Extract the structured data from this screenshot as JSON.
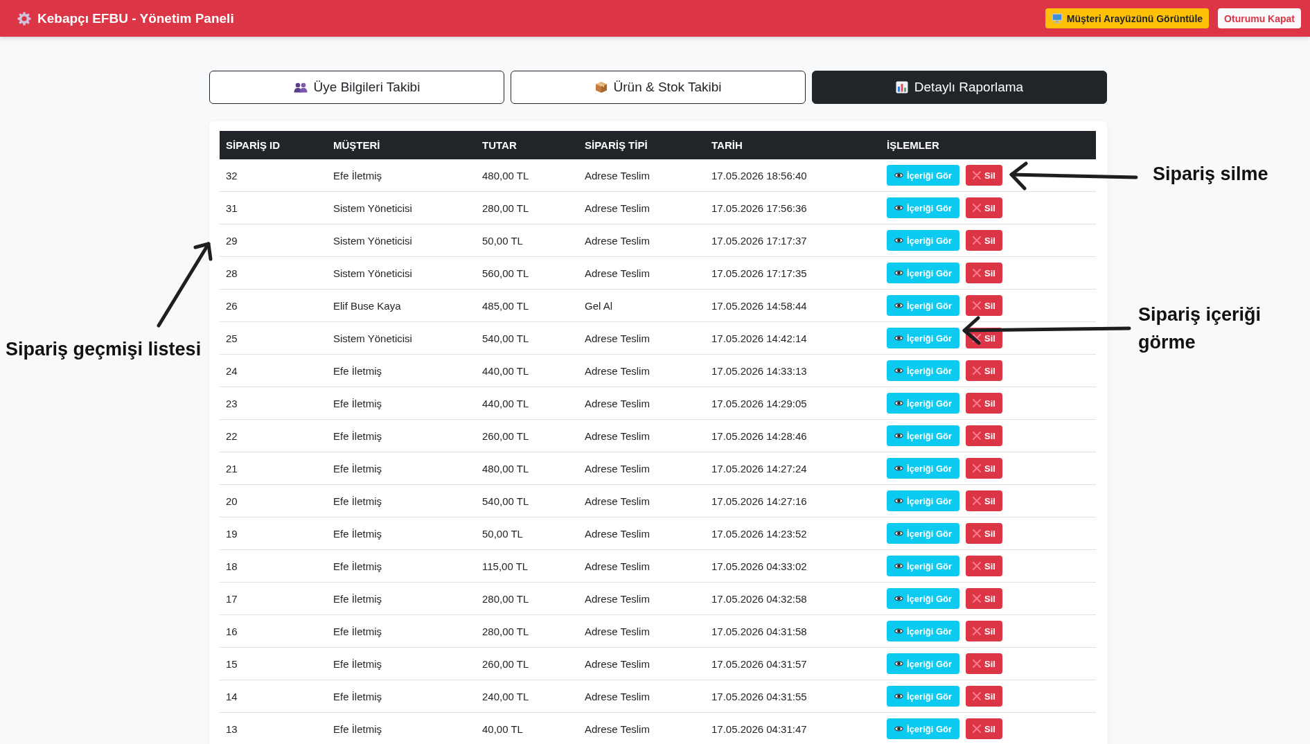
{
  "header": {
    "title": "Kebapçı EFBU - Yönetim Paneli",
    "buttons": [
      {
        "label": "Müşteri Arayüzünü Görüntüle",
        "kind": "warning"
      },
      {
        "label": "Oturumu Kapat",
        "kind": "light"
      }
    ]
  },
  "tabs": [
    {
      "label": "Üye Bilgileri Takibi",
      "selected": false
    },
    {
      "label": "Ürün & Stok Takibi",
      "selected": false
    },
    {
      "label": "Detaylı Raporlama",
      "selected": true
    }
  ],
  "orders_table": {
    "columns": [
      "SİPARİŞ ID",
      "MÜŞTERİ",
      "TUTAR",
      "SİPARİŞ TİPİ",
      "TARİH",
      "İŞLEMLER"
    ],
    "rows": [
      {
        "id": "32",
        "customer": "Efe İletmiş",
        "amount": "480,00 TL",
        "order_type": "Adrese Teslim",
        "date": "17.05.2026 18:56:40",
        "actions": [
          {
            "label": "İçeriği Gör",
            "kind": "view"
          },
          {
            "label": "Sil",
            "kind": "delete"
          }
        ]
      },
      {
        "id": "31",
        "customer": "Sistem Yöneticisi",
        "amount": "280,00 TL",
        "order_type": "Adrese Teslim",
        "date": "17.05.2026 17:56:36",
        "actions": [
          {
            "label": "İçeriği Gör",
            "kind": "view"
          },
          {
            "label": "Sil",
            "kind": "delete"
          }
        ]
      },
      {
        "id": "29",
        "customer": "Sistem Yöneticisi",
        "amount": "50,00 TL",
        "order_type": "Adrese Teslim",
        "date": "17.05.2026 17:17:37",
        "actions": [
          {
            "label": "İçeriği Gör",
            "kind": "view"
          },
          {
            "label": "Sil",
            "kind": "delete"
          }
        ]
      },
      {
        "id": "28",
        "customer": "Sistem Yöneticisi",
        "amount": "560,00 TL",
        "order_type": "Adrese Teslim",
        "date": "17.05.2026 17:17:35",
        "actions": [
          {
            "label": "İçeriği Gör",
            "kind": "view"
          },
          {
            "label": "Sil",
            "kind": "delete"
          }
        ]
      },
      {
        "id": "26",
        "customer": "Elif Buse Kaya",
        "amount": "485,00 TL",
        "order_type": "Gel Al",
        "date": "17.05.2026 14:58:44",
        "actions": [
          {
            "label": "İçeriği Gör",
            "kind": "view"
          },
          {
            "label": "Sil",
            "kind": "delete"
          }
        ]
      },
      {
        "id": "25",
        "customer": "Sistem Yöneticisi",
        "amount": "540,00 TL",
        "order_type": "Adrese Teslim",
        "date": "17.05.2026 14:42:14",
        "actions": [
          {
            "label": "İçeriği Gör",
            "kind": "view"
          },
          {
            "label": "Sil",
            "kind": "delete"
          }
        ]
      },
      {
        "id": "24",
        "customer": "Efe İletmiş",
        "amount": "440,00 TL",
        "order_type": "Adrese Teslim",
        "date": "17.05.2026 14:33:13",
        "actions": [
          {
            "label": "İçeriği Gör",
            "kind": "view"
          },
          {
            "label": "Sil",
            "kind": "delete"
          }
        ]
      },
      {
        "id": "23",
        "customer": "Efe İletmiş",
        "amount": "440,00 TL",
        "order_type": "Adrese Teslim",
        "date": "17.05.2026 14:29:05",
        "actions": [
          {
            "label": "İçeriği Gör",
            "kind": "view"
          },
          {
            "label": "Sil",
            "kind": "delete"
          }
        ]
      },
      {
        "id": "22",
        "customer": "Efe İletmiş",
        "amount": "260,00 TL",
        "order_type": "Adrese Teslim",
        "date": "17.05.2026 14:28:46",
        "actions": [
          {
            "label": "İçeriği Gör",
            "kind": "view"
          },
          {
            "label": "Sil",
            "kind": "delete"
          }
        ]
      },
      {
        "id": "21",
        "customer": "Efe İletmiş",
        "amount": "480,00 TL",
        "order_type": "Adrese Teslim",
        "date": "17.05.2026 14:27:24",
        "actions": [
          {
            "label": "İçeriği Gör",
            "kind": "view"
          },
          {
            "label": "Sil",
            "kind": "delete"
          }
        ]
      },
      {
        "id": "20",
        "customer": "Efe İletmiş",
        "amount": "540,00 TL",
        "order_type": "Adrese Teslim",
        "date": "17.05.2026 14:27:16",
        "actions": [
          {
            "label": "İçeriği Gör",
            "kind": "view"
          },
          {
            "label": "Sil",
            "kind": "delete"
          }
        ]
      },
      {
        "id": "19",
        "customer": "Efe İletmiş",
        "amount": "50,00 TL",
        "order_type": "Adrese Teslim",
        "date": "17.05.2026 14:23:52",
        "actions": [
          {
            "label": "İçeriği Gör",
            "kind": "view"
          },
          {
            "label": "Sil",
            "kind": "delete"
          }
        ]
      },
      {
        "id": "18",
        "customer": "Efe İletmiş",
        "amount": "115,00 TL",
        "order_type": "Adrese Teslim",
        "date": "17.05.2026 04:33:02",
        "actions": [
          {
            "label": "İçeriği Gör",
            "kind": "view"
          },
          {
            "label": "Sil",
            "kind": "delete"
          }
        ]
      },
      {
        "id": "17",
        "customer": "Efe İletmiş",
        "amount": "280,00 TL",
        "order_type": "Adrese Teslim",
        "date": "17.05.2026 04:32:58",
        "actions": [
          {
            "label": "İçeriği Gör",
            "kind": "view"
          },
          {
            "label": "Sil",
            "kind": "delete"
          }
        ]
      },
      {
        "id": "16",
        "customer": "Efe İletmiş",
        "amount": "280,00 TL",
        "order_type": "Adrese Teslim",
        "date": "17.05.2026 04:31:58",
        "actions": [
          {
            "label": "İçeriği Gör",
            "kind": "view"
          },
          {
            "label": "Sil",
            "kind": "delete"
          }
        ]
      },
      {
        "id": "15",
        "customer": "Efe İletmiş",
        "amount": "260,00 TL",
        "order_type": "Adrese Teslim",
        "date": "17.05.2026 04:31:57",
        "actions": [
          {
            "label": "İçeriği Gör",
            "kind": "view"
          },
          {
            "label": "Sil",
            "kind": "delete"
          }
        ]
      },
      {
        "id": "14",
        "customer": "Efe İletmiş",
        "amount": "240,00 TL",
        "order_type": "Adrese Teslim",
        "date": "17.05.2026 04:31:55",
        "actions": [
          {
            "label": "İçeriği Gör",
            "kind": "view"
          },
          {
            "label": "Sil",
            "kind": "delete"
          }
        ]
      },
      {
        "id": "13",
        "customer": "Efe İletmiş",
        "amount": "40,00 TL",
        "order_type": "Adrese Teslim",
        "date": "17.05.2026 04:31:47",
        "actions": [
          {
            "label": "İçeriği Gör",
            "kind": "view"
          },
          {
            "label": "Sil",
            "kind": "delete"
          }
        ]
      }
    ]
  },
  "annotations": [
    {
      "text": "Sipariş silme"
    },
    {
      "text": "Sipariş geçmişi listesi"
    },
    {
      "text": "Sipariş içeriği görme"
    }
  ]
}
